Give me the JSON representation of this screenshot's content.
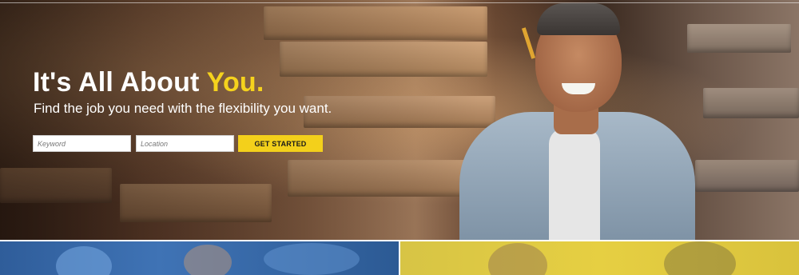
{
  "hero": {
    "headline_main": "It's All About",
    "headline_accent": "You.",
    "subheadline": "Find the job you need with the flexibility you want.",
    "accent_color": "#f3d01b"
  },
  "search": {
    "keyword_placeholder": "Keyword",
    "location_placeholder": "Location",
    "button_label": "GET STARTED"
  },
  "panels": {
    "left_color": "#3f73b5",
    "right_color": "#e6cf42"
  }
}
